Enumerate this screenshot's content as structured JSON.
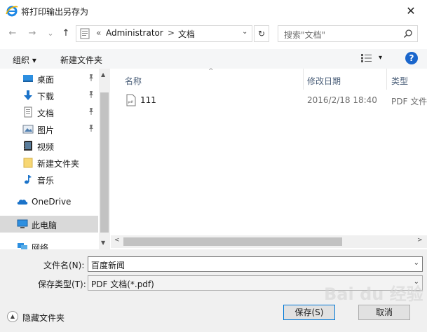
{
  "window": {
    "title": "将打印输出另存为",
    "close_glyph": "✕"
  },
  "nav": {
    "back_glyph": "←",
    "forward_glyph": "→",
    "recent_glyph": "⌄",
    "up_glyph": "↑",
    "address": {
      "chevrons": "«",
      "crumbs": [
        "Administrator",
        "文档"
      ],
      "separator": ">",
      "dropdown_glyph": "⌄"
    },
    "refresh_glyph": "↻",
    "search_placeholder": "搜索\"文档\""
  },
  "toolbar": {
    "organize_label": "组织 ▾",
    "new_folder_label": "新建文件夹",
    "view_dropdown_glyph": "▾",
    "help_label": "?"
  },
  "sidebar": {
    "items": [
      {
        "label": "桌面",
        "icon": "desktop-icon",
        "pinned": true
      },
      {
        "label": "下载",
        "icon": "download-icon",
        "pinned": true
      },
      {
        "label": "文档",
        "icon": "document-icon",
        "pinned": true
      },
      {
        "label": "图片",
        "icon": "picture-icon",
        "pinned": true
      },
      {
        "label": "视频",
        "icon": "video-icon",
        "pinned": false
      },
      {
        "label": "新建文件夹",
        "icon": "folder-icon",
        "pinned": false
      },
      {
        "label": "音乐",
        "icon": "music-icon",
        "pinned": false
      },
      {
        "label": "OneDrive",
        "icon": "cloud-icon",
        "pinned": false
      },
      {
        "label": "此电脑",
        "icon": "computer-icon",
        "pinned": false,
        "selected": true
      },
      {
        "label": "网络",
        "icon": "network-icon",
        "pinned": false
      }
    ],
    "scroll_up_glyph": "▲",
    "scroll_down_glyph": "▼"
  },
  "filelist": {
    "columns": [
      "名称",
      "修改日期",
      "类型"
    ],
    "sort_glyph": "^",
    "rows": [
      {
        "name": "111",
        "date": "2016/2/18 18:40",
        "type": "PDF 文件"
      }
    ],
    "hscroll_left_glyph": "<",
    "hscroll_right_glyph": ">"
  },
  "form": {
    "filename_label": "文件名(N):",
    "filename_value": "百度新闻",
    "filetype_label": "保存类型(T):",
    "filetype_value": "PDF 文档(*.pdf)",
    "dropdown_glyph": "⌄",
    "hide_folders_label": "隐藏文件夹",
    "hide_folders_glyph": "▲",
    "save_label": "保存(S)",
    "cancel_label": "取消"
  },
  "watermark": "Bai du 经验",
  "colors": {
    "accent": "#0078d7",
    "help": "#1a66cc",
    "selected_bg": "#d9d9d9"
  }
}
